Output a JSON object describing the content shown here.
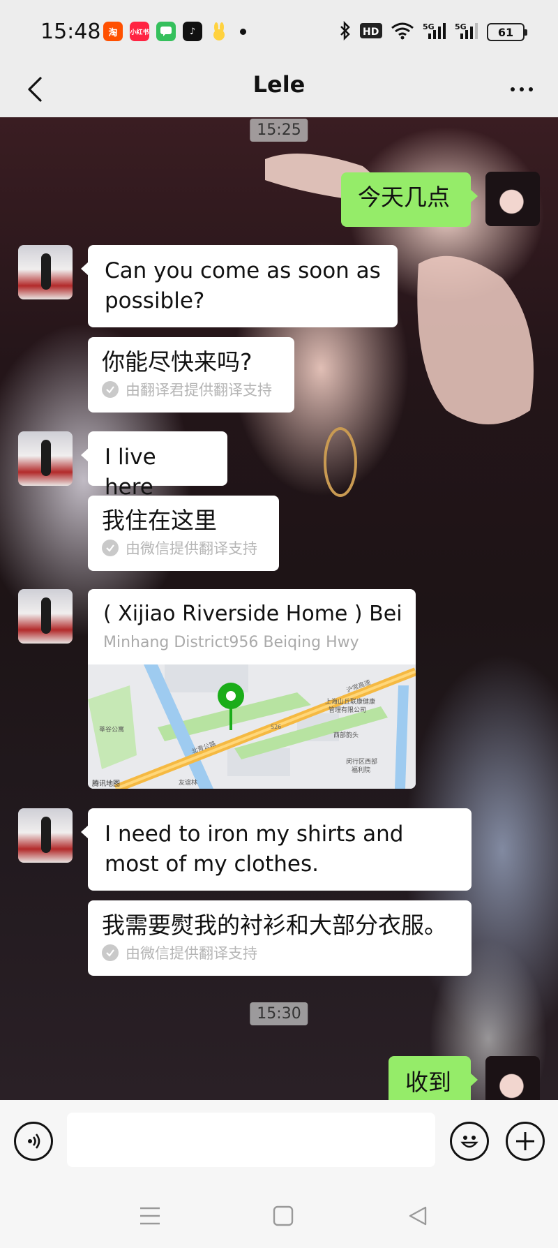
{
  "status_bar": {
    "time": "15:48",
    "app_icons": [
      {
        "name": "taobao-icon",
        "glyph": "淘",
        "color": "#ff5000"
      },
      {
        "name": "xiaohongshu-icon",
        "glyph": "小红书",
        "color": "#ff2442"
      },
      {
        "name": "message-icon",
        "glyph": "",
        "color": "#35c05c"
      },
      {
        "name": "tiktok-icon",
        "glyph": "♪",
        "color": "#111111"
      },
      {
        "name": "rabbit-app-icon",
        "glyph": "",
        "color": "#ffd23f"
      }
    ],
    "battery": "61"
  },
  "header": {
    "title": "Lele"
  },
  "chat": {
    "timestamps": [
      "15:25",
      "15:30"
    ],
    "messages": [
      {
        "id": "m1",
        "side": "right",
        "text": "今天几点"
      },
      {
        "id": "m2",
        "side": "left",
        "text": "Can you come as soon as possible?",
        "translation": "你能尽快来吗?",
        "translation_note": "由翻译君提供翻译支持"
      },
      {
        "id": "m3",
        "side": "left",
        "text": "I live here",
        "translation": "我住在这里",
        "translation_note": "由微信提供翻译支持"
      },
      {
        "id": "m4",
        "side": "left",
        "type": "location",
        "title": "( Xijiao Riverside Home ) Bei...",
        "address": "Minhang District956 Beiqing Hwy"
      },
      {
        "id": "m5",
        "side": "left",
        "text": "I need to iron my shirts and most of my clothes.",
        "translation": "我需要熨我的衬衫和大部分衣服。",
        "translation_note": "由微信提供翻译支持"
      },
      {
        "id": "m6",
        "side": "right",
        "text": "收到"
      }
    ]
  },
  "map": {
    "labels": [
      {
        "text": "上海山丘联康健康",
        "size": 9
      },
      {
        "text": "管理有限公司",
        "size": 9
      },
      {
        "text": "西部韵头",
        "size": 9
      },
      {
        "text": "闵行区西部",
        "size": 9
      },
      {
        "text": "福利院",
        "size": 9
      },
      {
        "text": "莘谷公寓",
        "size": 9
      },
      {
        "text": "友谊林",
        "size": 9
      },
      {
        "text": "腾讯地图",
        "size": 10
      },
      {
        "text": "北青公路",
        "size": 9
      },
      {
        "text": "沪常高速",
        "size": 9
      },
      {
        "text": "S26",
        "size": 8
      }
    ],
    "colors": {
      "road": "#f5b942",
      "green": "#b7e3a1",
      "water": "#9ecbf0",
      "base": "#e9eaed",
      "pin": "#1aad19"
    }
  },
  "input_bar": {
    "placeholder": ""
  },
  "colors": {
    "sent_bubble": "#95ec69",
    "received_bubble": "#ffffff",
    "header_bg": "#ededed"
  }
}
